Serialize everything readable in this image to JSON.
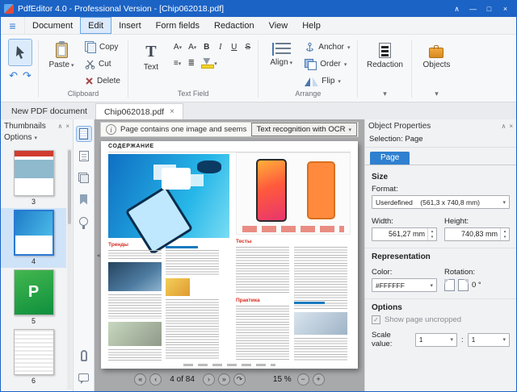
{
  "icons": {
    "hamburger": "≡",
    "caret_down": "▾",
    "caret_up": "▴",
    "close": "×",
    "minimize": "—",
    "maximize": "□",
    "chevron_up": "∧",
    "first": "«",
    "prev": "‹",
    "next": "›",
    "last": "»",
    "undo": "↶",
    "redo": "↷",
    "zoom_out": "−",
    "zoom_in": "+",
    "info": "i",
    "check": "✓",
    "collapse_left": "◂",
    "text_tool": "T"
  },
  "window": {
    "title": "PdfEditor 4.0 - Professional Version - [Chip062018.pdf]"
  },
  "menu": {
    "items": [
      "Document",
      "Edit",
      "Insert",
      "Form fields",
      "Redaction",
      "View",
      "Help"
    ]
  },
  "ribbon": {
    "groups": {
      "clipboard": "Clipboard",
      "text_field": "Text Field",
      "arrange": "Arrange"
    },
    "paste": "Paste",
    "copy": "Copy",
    "cut": "Cut",
    "delete": "Delete",
    "text": "Text",
    "format": {
      "font": "A",
      "style": "A",
      "bold": "B",
      "italic": "I",
      "underline": "U",
      "strike": "S",
      "align_left": "≡",
      "align_center": "≣"
    },
    "align": "Align",
    "anchor": "Anchor",
    "order": "Order",
    "flip": "Flip",
    "redaction": "Redaction",
    "objects": "Objects"
  },
  "tabs": {
    "tab1": "New PDF document",
    "tab2": "Chip062018.pdf"
  },
  "thumbnails": {
    "title": "Thumbnails",
    "options": "Options",
    "pages": [
      {
        "num": "3"
      },
      {
        "num": "4"
      },
      {
        "num": "5",
        "art": "P"
      },
      {
        "num": "6"
      }
    ]
  },
  "notification": {
    "text": "Page contains one image and seems to be scanned",
    "button": "Text recognition with OCR"
  },
  "doc": {
    "header": "СОДЕРЖАНИЕ",
    "sec1": "Тренды",
    "sec2": "Тесты",
    "sec3": "Практика"
  },
  "nav": {
    "page": "4 of 84",
    "zoom": "15 %"
  },
  "props": {
    "title": "Object Properties",
    "selection": "Selection: Page",
    "tab": "Page",
    "size": {
      "title": "Size",
      "format_label": "Format:",
      "format": "Userdefined    (561,3 x 740,8 mm)",
      "width_label": "Width:",
      "width": "561,27 mm",
      "height_label": "Height:",
      "height": "740,83 mm"
    },
    "rep": {
      "title": "Representation",
      "color_label": "Color:",
      "color": "#FFFFFF",
      "rotation_label": "Rotation:",
      "rotation": "0 °"
    },
    "options": {
      "title": "Options",
      "uncropped": "Show page uncropped",
      "scale_label": "Scale value:",
      "scale1": "1",
      "colon": ":",
      "scale2": "1"
    }
  }
}
